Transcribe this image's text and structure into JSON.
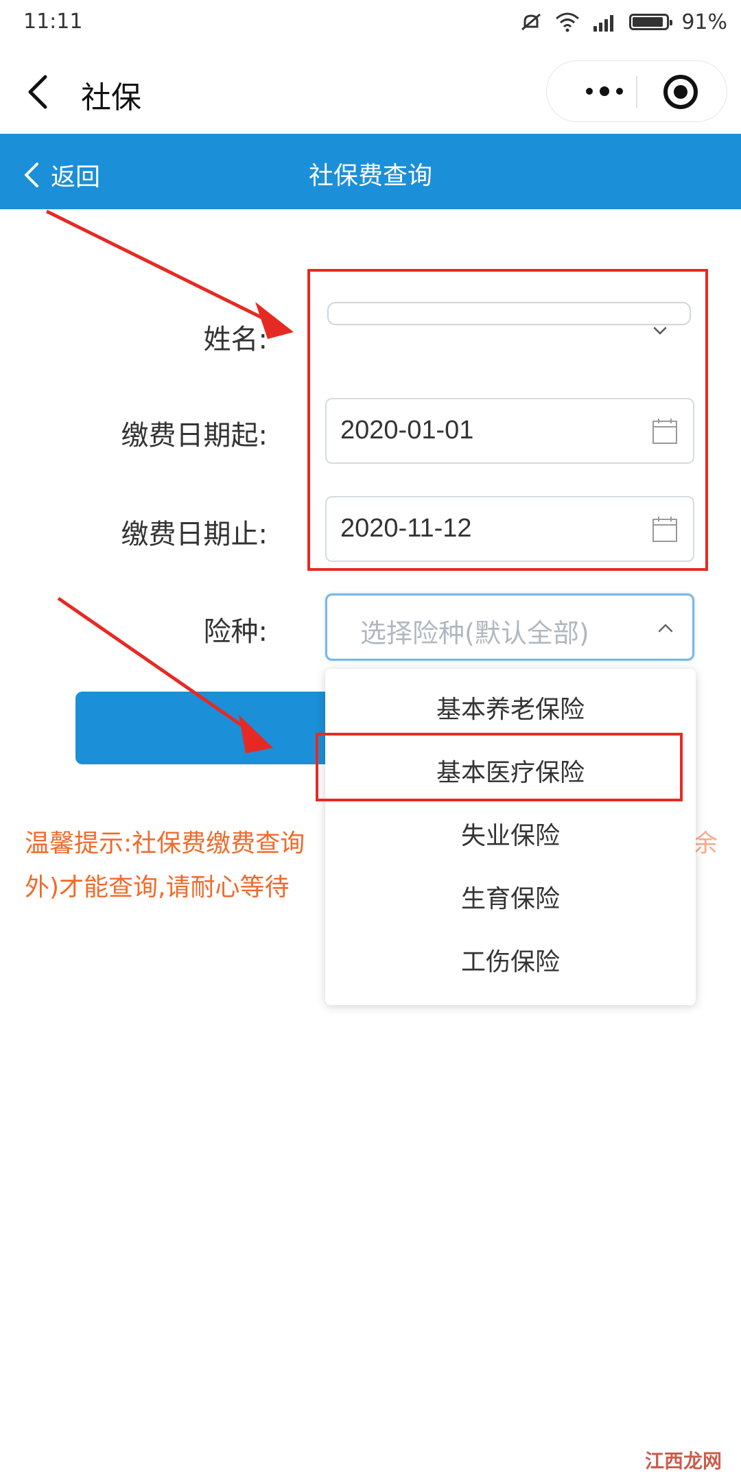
{
  "status_bar": {
    "time": "11:11",
    "battery": "91%",
    "battery_level": 0.91
  },
  "app_header": {
    "title": "社保"
  },
  "nav": {
    "back_label": "返回",
    "title": "社保费查询"
  },
  "form": {
    "name_label": "姓名:",
    "start_label": "缴费日期起:",
    "start_value": "2020-01-01",
    "end_label": "缴费日期止:",
    "end_value": "2020-11-12",
    "type_label": "险种:",
    "type_placeholder": "选择险种(默认全部)"
  },
  "dropdown": {
    "options": [
      "基本养老保险",
      "基本医疗保险",
      "失业保险",
      "生育保险",
      "工伤保险"
    ]
  },
  "tip": {
    "line1": "温馨提示:社保费缴费查询",
    "line2": "外)才能查询,请耐心等待",
    "right_fragment": "余"
  },
  "watermark": "江西龙网",
  "colors": {
    "nav_blue": "#1b8fd8",
    "tip_orange": "#f06a2a",
    "annotation_red": "#e62a23"
  }
}
